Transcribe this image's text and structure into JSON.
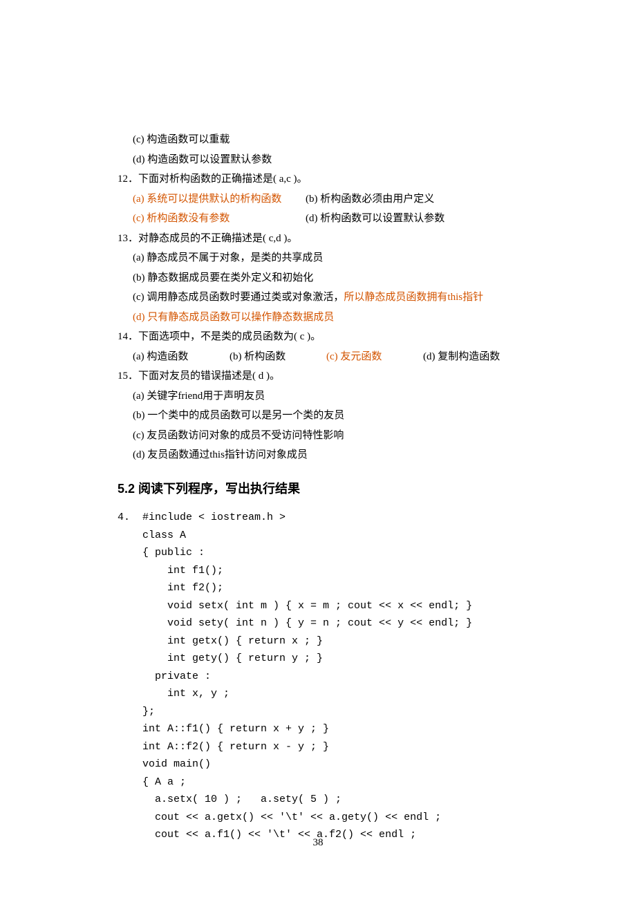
{
  "q11": {
    "c": "(c) 构造函数可以重载",
    "d": "(d) 构造函数可以设置默认参数"
  },
  "q12": {
    "stem": "12．下面对析构函数的正确描述是(  a,c  )。",
    "a": "(a) 系统可以提供默认的析构函数",
    "b": "(b) 析构函数必须由用户定义",
    "c": "(c) 析构函数没有参数",
    "d": "(d) 析构函数可以设置默认参数"
  },
  "q13": {
    "stem": "13．对静态成员的不正确描述是(  c,d  )。",
    "a": "(a) 静态成员不属于对象，是类的共享成员",
    "b": "(b) 静态数据成员要在类外定义和初始化",
    "c_prefix": "(c) 调用静态成员函数时要通过类或对象激活，",
    "c_suffix": "所以静态成员函数拥有this指针",
    "d": "(d) 只有静态成员函数可以操作静态数据成员"
  },
  "q14": {
    "stem": "14．下面选项中，不是类的成员函数为(  c  )。",
    "a": "(a) 构造函数",
    "b": "(b) 析构函数",
    "c": "(c) 友元函数",
    "d": "(d) 复制构造函数"
  },
  "q15": {
    "stem": "15．下面对友员的错误描述是(  d  )。",
    "a": "(a) 关键字friend用于声明友员",
    "b": "(b) 一个类中的成员函数可以是另一个类的友员",
    "c": "(c) 友员函数访问对象的成员不受访问特性影响",
    "d": "(d) 友员函数通过this指针访问对象成员"
  },
  "section_title": "5.2  阅读下列程序，写出执行结果",
  "code": "4.  #include < iostream.h >\n    class A\n    { public :\n        int f1();\n        int f2();\n        void setx( int m ) { x = m ; cout << x << endl; }\n        void sety( int n ) { y = n ; cout << y << endl; }\n        int getx() { return x ; }\n        int gety() { return y ; }\n      private :\n        int x, y ;\n    };\n    int A::f1() { return x + y ; }\n    int A::f2() { return x - y ; }\n    void main()\n    { A a ;\n      a.setx( 10 ) ;   a.sety( 5 ) ;\n      cout << a.getx() << '\\t' << a.gety() << endl ;\n      cout << a.f1() << '\\t' << a.f2() << endl ;",
  "page_number": "38"
}
